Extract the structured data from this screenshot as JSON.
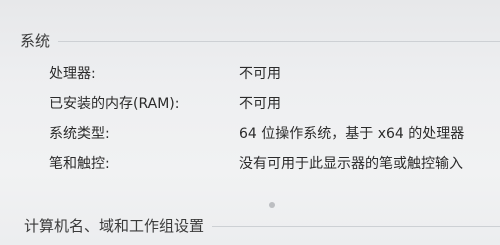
{
  "system_section": {
    "title": "系统",
    "rows": [
      {
        "label": "处理器:",
        "value": "不可用"
      },
      {
        "label": "已安装的内存(RAM):",
        "value": "不可用"
      },
      {
        "label": "系统类型:",
        "value": "64 位操作系统，基于 x64 的处理器"
      },
      {
        "label": "笔和触控:",
        "value": "没有可用于此显示器的笔或触控输入"
      }
    ]
  },
  "workgroup_section": {
    "title": "计算机名、域和工作组设置"
  }
}
